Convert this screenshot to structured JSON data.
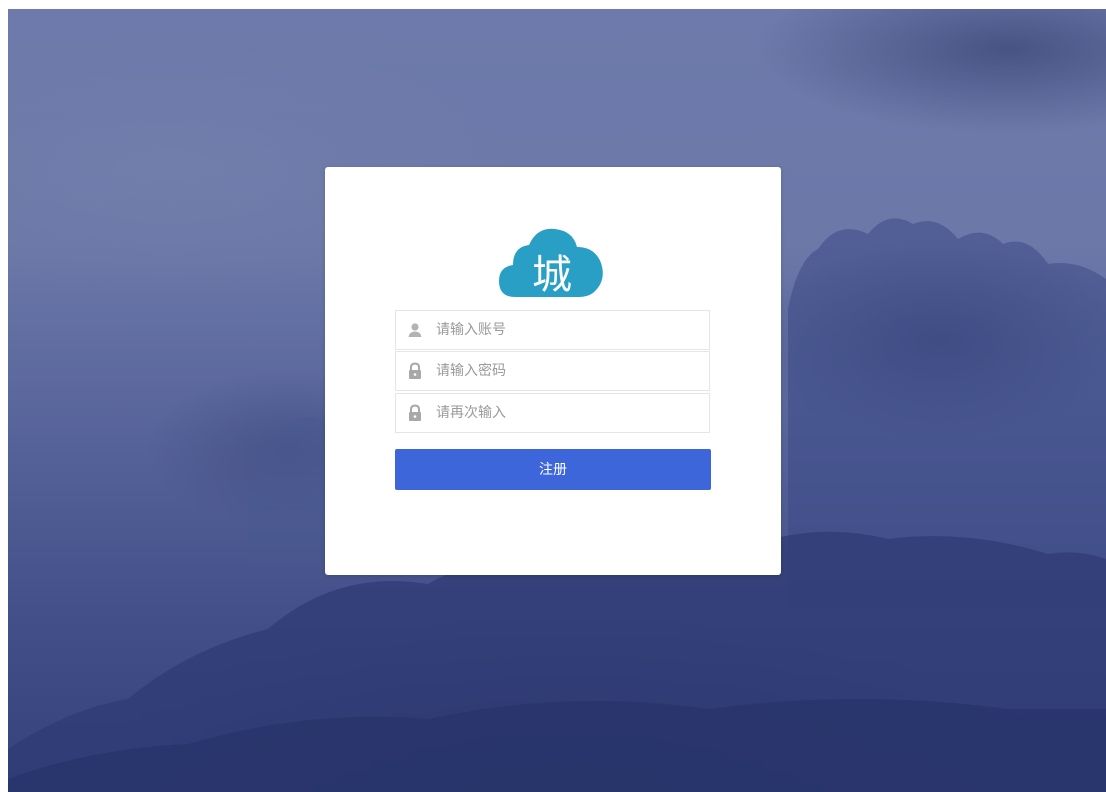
{
  "app": {
    "logo_text": "城",
    "brand_color": "#2a9fc6"
  },
  "form": {
    "account": {
      "placeholder": "请输入账号",
      "value": ""
    },
    "password": {
      "placeholder": "请输入密码",
      "value": ""
    },
    "confirm_password": {
      "placeholder": "请再次输入",
      "value": ""
    },
    "submit_label": "注册",
    "submit_color": "#3d66db"
  },
  "icons": {
    "account": "user-icon",
    "password": "lock-icon",
    "confirm_password": "lock-icon"
  }
}
